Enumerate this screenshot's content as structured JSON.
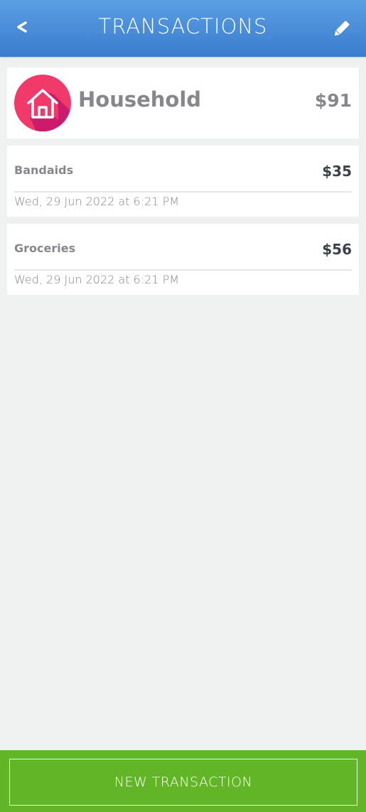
{
  "header": {
    "title": "TRANSACTIONS",
    "back_label": "<",
    "back_icon": "chevron-left-icon",
    "edit_icon": "pencil-icon"
  },
  "category": {
    "name": "Household",
    "total": "$91",
    "icon": "house-icon",
    "icon_color": "#e8256b"
  },
  "transactions": [
    {
      "name": "Bandaids",
      "amount": "$35",
      "date": "Wed, 29 Jun 2022 at 6:21 PM"
    },
    {
      "name": "Groceries",
      "amount": "$56",
      "date": "Wed, 29 Jun 2022 at 6:21 PM"
    }
  ],
  "footer": {
    "new_transaction_label": "NEW TRANSACTION"
  },
  "colors": {
    "header": "#4a8fd9",
    "footer": "#62b526",
    "background": "#eff1f0"
  }
}
